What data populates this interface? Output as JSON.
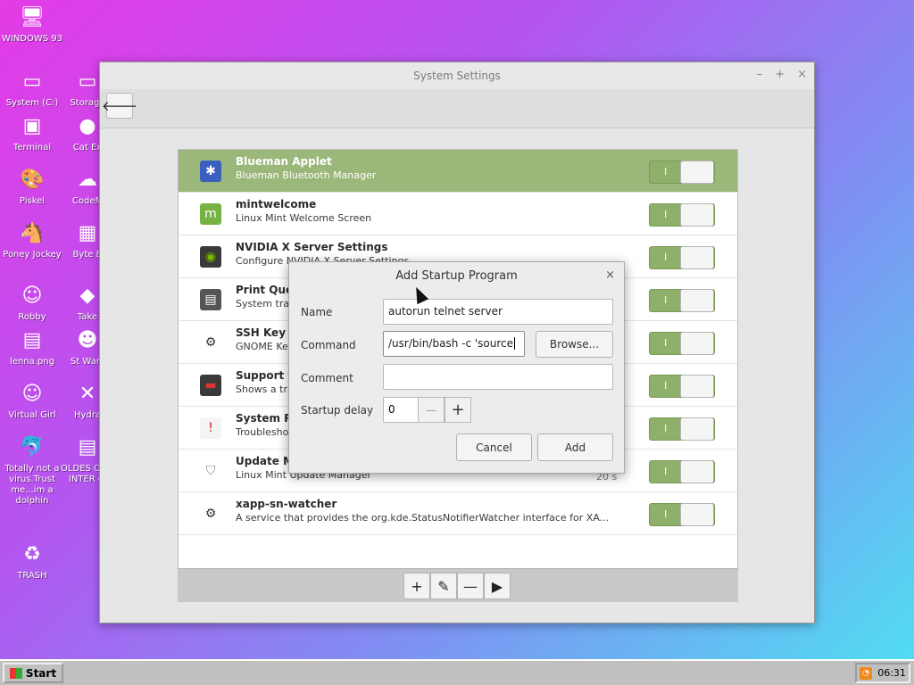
{
  "desktop": {
    "icons": [
      {
        "label": "WINDOWS 93",
        "glyph": "🖥"
      },
      {
        "label": "System (C:)",
        "glyph": "▭"
      },
      {
        "label": "Storage",
        "glyph": "▭"
      },
      {
        "label": "Terminal",
        "glyph": "▣"
      },
      {
        "label": "Cat Ex",
        "glyph": "●"
      },
      {
        "label": "Piskel",
        "glyph": "🎨"
      },
      {
        "label": "CodeM",
        "glyph": "☁"
      },
      {
        "label": "Poney Jockey",
        "glyph": "🐴"
      },
      {
        "label": "Byte B",
        "glyph": "▦"
      },
      {
        "label": "Robby",
        "glyph": "☺"
      },
      {
        "label": "Take",
        "glyph": "◆"
      },
      {
        "label": "lenna.png",
        "glyph": "▤"
      },
      {
        "label": "St Wars",
        "glyph": "☻"
      },
      {
        "label": "Virtual Girl",
        "glyph": "☺"
      },
      {
        "label": "Hydra",
        "glyph": "✕"
      },
      {
        "label": "Totally not a virus.Trust me...im a dolphin",
        "glyph": "🐬"
      },
      {
        "label": "OLDES OF T INTER gi",
        "glyph": "▤"
      },
      {
        "label": "TRASH",
        "glyph": "♻"
      }
    ]
  },
  "window": {
    "title": "System Settings",
    "controls": {
      "minimize": "–",
      "maximize": "+",
      "close": "×"
    },
    "back_glyph": "🡐"
  },
  "startup_list": [
    {
      "title": "Blueman Applet",
      "desc": "Blueman Bluetooth Manager",
      "icon": "✱",
      "icon_bg": "#3a5fbf",
      "icon_color": "#ffffff",
      "selected": true,
      "switch": "I",
      "delay": ""
    },
    {
      "title": "mintwelcome",
      "desc": "Linux Mint Welcome Screen",
      "icon": "m",
      "icon_bg": "#77b342",
      "icon_color": "#ffffff",
      "selected": false,
      "switch": "I",
      "delay": ""
    },
    {
      "title": "NVIDIA X Server Settings",
      "desc": "Configure NVIDIA X Server Settings",
      "icon": "◉",
      "icon_bg": "#3a3a3a",
      "icon_color": "#76b900",
      "selected": false,
      "switch": "I",
      "delay": ""
    },
    {
      "title": "Print Que",
      "desc": "System tray",
      "icon": "▤",
      "icon_bg": "#555555",
      "icon_color": "#ffffff",
      "selected": false,
      "switch": "I",
      "delay": ""
    },
    {
      "title": "SSH Key A",
      "desc": "GNOME Key",
      "icon": "⚙",
      "icon_bg": "transparent",
      "icon_color": "#333333",
      "selected": false,
      "switch": "I",
      "delay": ""
    },
    {
      "title": "Support f",
      "desc": "Shows a tray",
      "icon": "▬",
      "icon_bg": "#3a3a3a",
      "icon_color": "#d33",
      "selected": false,
      "switch": "I",
      "delay": ""
    },
    {
      "title": "System Re",
      "desc": "Troubleshoo",
      "icon": "!",
      "icon_bg": "#f4f4f4",
      "icon_color": "#c82020",
      "selected": false,
      "switch": "I",
      "delay": ""
    },
    {
      "title": "Update M",
      "desc": "Linux Mint Update Manager",
      "icon": "⛉",
      "icon_bg": "transparent",
      "icon_color": "#888888",
      "selected": false,
      "switch": "I",
      "delay": "20 s"
    },
    {
      "title": "xapp-sn-watcher",
      "desc": "A service that provides the org.kde.StatusNotifierWatcher interface for XA...",
      "icon": "⚙",
      "icon_bg": "transparent",
      "icon_color": "#333333",
      "selected": false,
      "switch": "I",
      "delay": ""
    }
  ],
  "footer_buttons": [
    {
      "name": "add",
      "glyph": "+"
    },
    {
      "name": "edit",
      "glyph": "✎"
    },
    {
      "name": "remove",
      "glyph": "—"
    },
    {
      "name": "run",
      "glyph": "▶"
    }
  ],
  "dialog": {
    "title": "Add Startup Program",
    "close": "×",
    "name_label": "Name",
    "name_value": "autorun telnet server",
    "command_label": "Command",
    "command_value": "/usr/bin/bash -c 'source",
    "browse_label": "Browse...",
    "comment_label": "Comment",
    "comment_value": "",
    "delay_label": "Startup delay",
    "delay_value": "0",
    "minus": "—",
    "plus": "+",
    "cancel_label": "Cancel",
    "add_label": "Add"
  },
  "taskbar": {
    "start_label": "Start",
    "time": "06:31",
    "rss_glyph": "◔"
  }
}
